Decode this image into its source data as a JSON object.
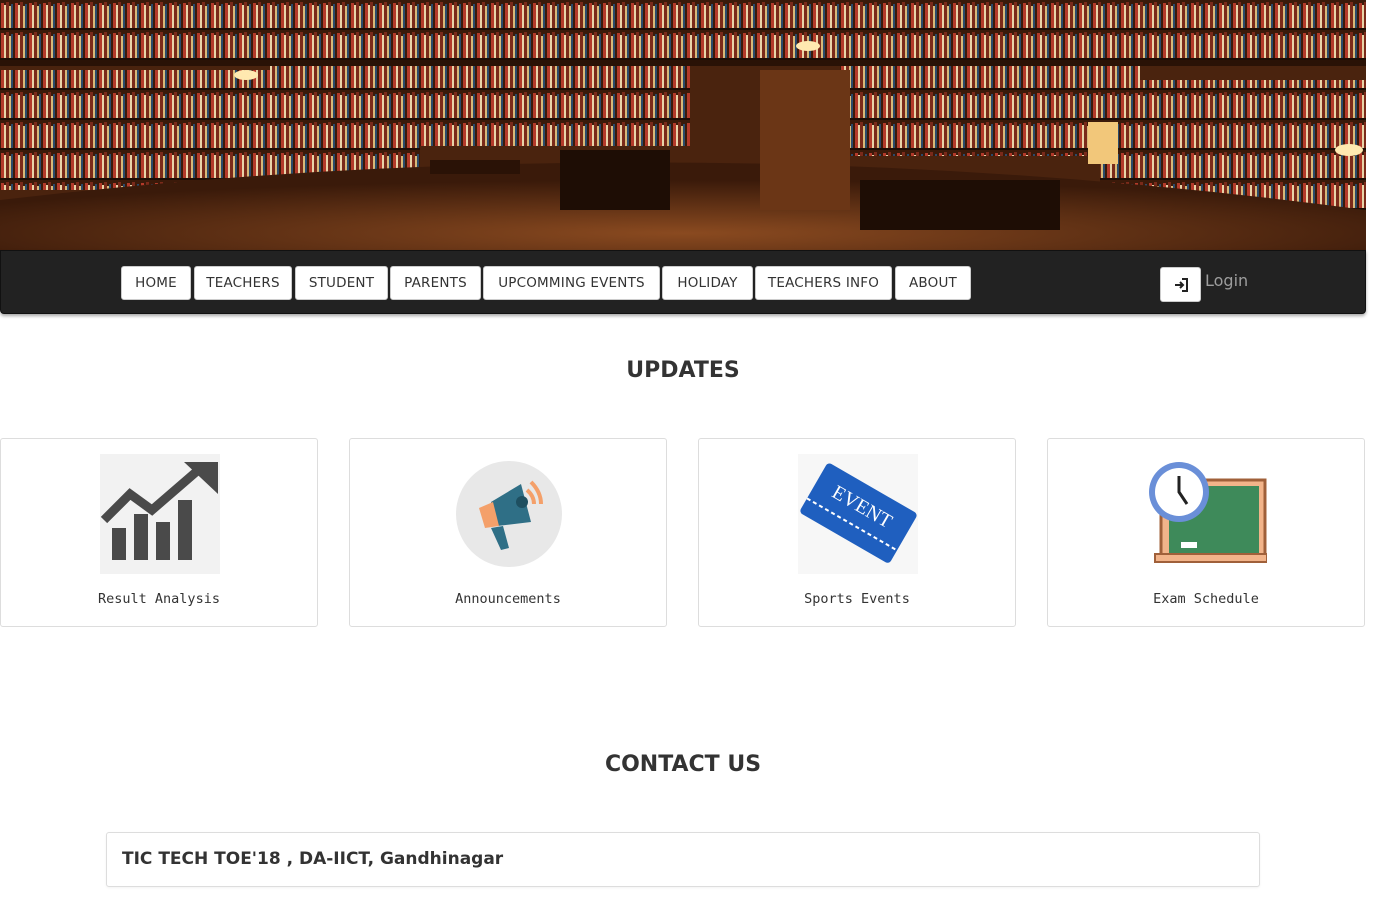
{
  "hero": {
    "image_name": "library-bookshelves-banner"
  },
  "nav": {
    "items": [
      {
        "label": "HOME"
      },
      {
        "label": "TEACHERS"
      },
      {
        "label": "STUDENT"
      },
      {
        "label": "PARENTS"
      },
      {
        "label": "UPCOMMING EVENTS"
      },
      {
        "label": "HOLIDAY"
      },
      {
        "label": "TEACHERS INFO"
      },
      {
        "label": "ABOUT"
      }
    ],
    "login_icon": "login-arrow-icon",
    "login_label": "Login"
  },
  "updates": {
    "title": "UPDATES",
    "cards": [
      {
        "label": "Result Analysis",
        "icon": "growth-chart-icon"
      },
      {
        "label": "Announcements",
        "icon": "megaphone-icon"
      },
      {
        "label": "Sports Events",
        "icon": "event-ticket-icon",
        "icon_text": "EVENT"
      },
      {
        "label": "Exam Schedule",
        "icon": "clock-chalkboard-icon"
      }
    ]
  },
  "contact": {
    "title": "CONTACT US",
    "address": "TIC TECH TOE'18 , DA-IICT, Gandhinagar"
  },
  "colors": {
    "navbar_bg": "#222222",
    "card_border": "#dddddd",
    "ticket_blue": "#1f5fbf",
    "chalkboard_green": "#3e8a5a"
  }
}
